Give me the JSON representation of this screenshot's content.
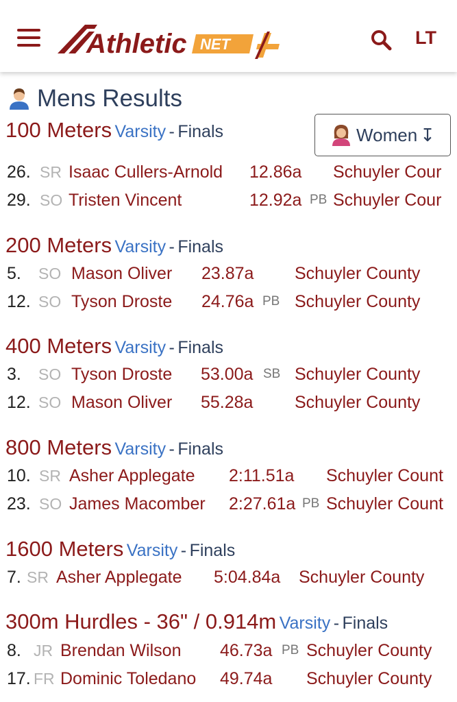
{
  "header": {
    "brand": "Athletic",
    "brand_suffix": "NET",
    "locale": "LT"
  },
  "page_title": "Mens Results",
  "gender_toggle": {
    "label": "Women",
    "arrow": "↧"
  },
  "connector": "-",
  "events": [
    {
      "name": "100 Meters",
      "level": "Varsity",
      "round": "Finals",
      "results": [
        {
          "place": "26.",
          "grade": "SR",
          "athlete": "Isaac Cullers-Arnold",
          "mark": "12.86a",
          "note": "",
          "team": "Schuyler Cour"
        },
        {
          "place": "29.",
          "grade": "SO",
          "athlete": "Tristen Vincent",
          "mark": "12.92a",
          "note": "PB",
          "team": "Schuyler Cour"
        }
      ]
    },
    {
      "name": "200 Meters",
      "level": "Varsity",
      "round": "Finals",
      "results": [
        {
          "place": "5.",
          "grade": "SO",
          "athlete": "Mason Oliver",
          "mark": "23.87a",
          "note": "",
          "team": "Schuyler County"
        },
        {
          "place": "12.",
          "grade": "SO",
          "athlete": "Tyson Droste",
          "mark": "24.76a",
          "note": "PB",
          "team": "Schuyler County"
        }
      ]
    },
    {
      "name": "400 Meters",
      "level": "Varsity",
      "round": "Finals",
      "results": [
        {
          "place": "3.",
          "grade": "SO",
          "athlete": "Tyson Droste",
          "mark": "53.00a",
          "note": "SB",
          "team": "Schuyler County"
        },
        {
          "place": "12.",
          "grade": "SO",
          "athlete": "Mason Oliver",
          "mark": "55.28a",
          "note": "",
          "team": "Schuyler County"
        }
      ]
    },
    {
      "name": "800 Meters",
      "level": "Varsity",
      "round": "Finals",
      "results": [
        {
          "place": "10.",
          "grade": "SR",
          "athlete": "Asher Applegate",
          "mark": "2:11.51a",
          "note": "",
          "team": "Schuyler Count"
        },
        {
          "place": "23.",
          "grade": "SO",
          "athlete": "James Macomber",
          "mark": "2:27.61a",
          "note": "PB",
          "team": "Schuyler Count"
        }
      ]
    },
    {
      "name": "1600 Meters",
      "level": "Varsity",
      "round": "Finals",
      "results": [
        {
          "place": "7.",
          "grade": "SR",
          "athlete": "Asher Applegate",
          "mark": "5:04.84a",
          "note": "",
          "team": "Schuyler County"
        }
      ]
    },
    {
      "name": "300m Hurdles - 36\" / 0.914m",
      "level": "Varsity",
      "round": "Finals",
      "results": [
        {
          "place": "8.",
          "grade": "JR",
          "athlete": "Brendan Wilson",
          "mark": "46.73a",
          "note": "PB",
          "team": "Schuyler County"
        },
        {
          "place": "17.",
          "grade": "FR",
          "athlete": "Dominic Toledano",
          "mark": "49.74a",
          "note": "",
          "team": "Schuyler County"
        }
      ]
    }
  ],
  "colors": {
    "brand_red": "#8b1a1a",
    "level_blue": "#3a72c4",
    "title_navy": "#2e3f5c",
    "logo_gold": "#f2a33a",
    "grade_gray": "#b3b3b3"
  },
  "icons": {
    "menu": "hamburger-icon",
    "search": "search-icon",
    "person_male": "male-person-icon",
    "person_female": "female-person-icon"
  }
}
